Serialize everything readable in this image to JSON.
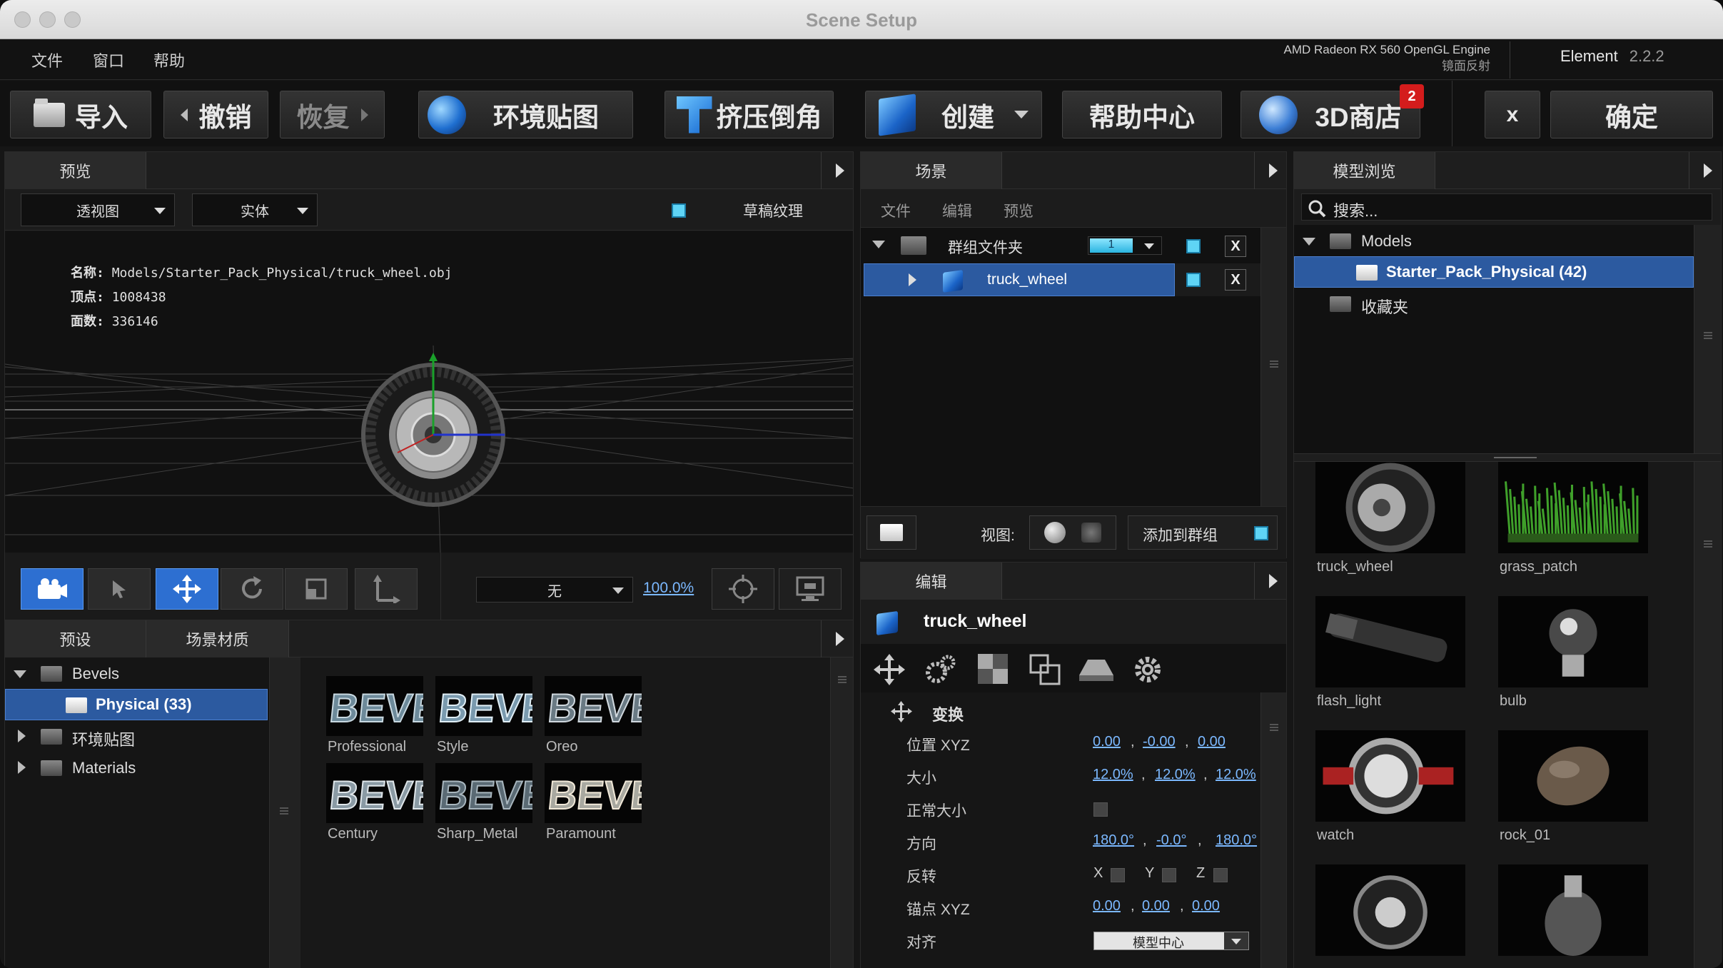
{
  "window": {
    "title": "Scene Setup"
  },
  "menu": {
    "items": [
      "文件",
      "窗口",
      "帮助"
    ]
  },
  "gpu": {
    "engine": "AMD Radeon RX 560 OpenGL Engine",
    "reflection": "镜面反射"
  },
  "app": {
    "name": "Element",
    "version": "2.2.2"
  },
  "toolbar": {
    "import": "导入",
    "undo": "撤销",
    "redo": "恢复",
    "env_map": "环境贴图",
    "extrude": "挤压倒角",
    "create": "创建",
    "help": "帮助中心",
    "store": "3D商店",
    "store_badge": "2",
    "close": "x",
    "confirm": "确定"
  },
  "preview": {
    "tab": "预览",
    "view_mode": "透视图",
    "shade_mode": "实体",
    "draft_texture": "草稿纹理",
    "info": {
      "name_label": "名称:",
      "name_value": "Models/Starter_Pack_Physical/truck_wheel.obj",
      "vertices_label": "顶点:",
      "vertices_value": "1008438",
      "faces_label": "面数:",
      "faces_value": "336146"
    },
    "axis_select": "无",
    "zoom": "100.0%"
  },
  "presets": {
    "tabs": [
      "预设",
      "场景材质"
    ],
    "tree": [
      {
        "label": "Bevels",
        "expanded": true
      },
      {
        "label": "Physical (33)",
        "selected": true
      },
      {
        "label": "环境贴图"
      },
      {
        "label": "Materials"
      }
    ],
    "thumbs": [
      "Professional",
      "Style",
      "Oreo",
      "Century",
      "Sharp_Metal",
      "Paramount"
    ]
  },
  "scene": {
    "tab": "场景",
    "subtabs": [
      "文件",
      "编辑",
      "预览"
    ],
    "group_folder": "群组文件夹",
    "group_count": "1",
    "item": "truck_wheel",
    "view_label": "视图:",
    "add_to_group": "添加到群组"
  },
  "edit": {
    "tab": "编辑",
    "object": "truck_wheel",
    "section": "变换",
    "position_label": "位置 XYZ",
    "position": [
      "0.00",
      "-0.00",
      "0.00"
    ],
    "size_label": "大小",
    "size": [
      "12.0%",
      "12.0%",
      "12.0%"
    ],
    "normal_size_label": "正常大小",
    "orientation_label": "方向",
    "orientation": [
      "180.0°",
      "-0.0°",
      "180.0°"
    ],
    "flip_label": "反转",
    "flip_axes": [
      "X",
      "Y",
      "Z"
    ],
    "anchor_label": "锚点 XYZ",
    "anchor": [
      "0.00",
      "0.00",
      "0.00"
    ],
    "align_label": "对齐",
    "align_value": "模型中心"
  },
  "browser": {
    "tab": "模型浏览",
    "search_placeholder": "搜索...",
    "tree": [
      {
        "label": "Models",
        "expanded": true
      },
      {
        "label": "Starter_Pack_Physical (42)",
        "selected": true
      },
      {
        "label": "收藏夹"
      }
    ],
    "thumbs": [
      "truck_wheel",
      "grass_patch",
      "flash_light",
      "bulb",
      "watch",
      "rock_01",
      "",
      ""
    ]
  }
}
